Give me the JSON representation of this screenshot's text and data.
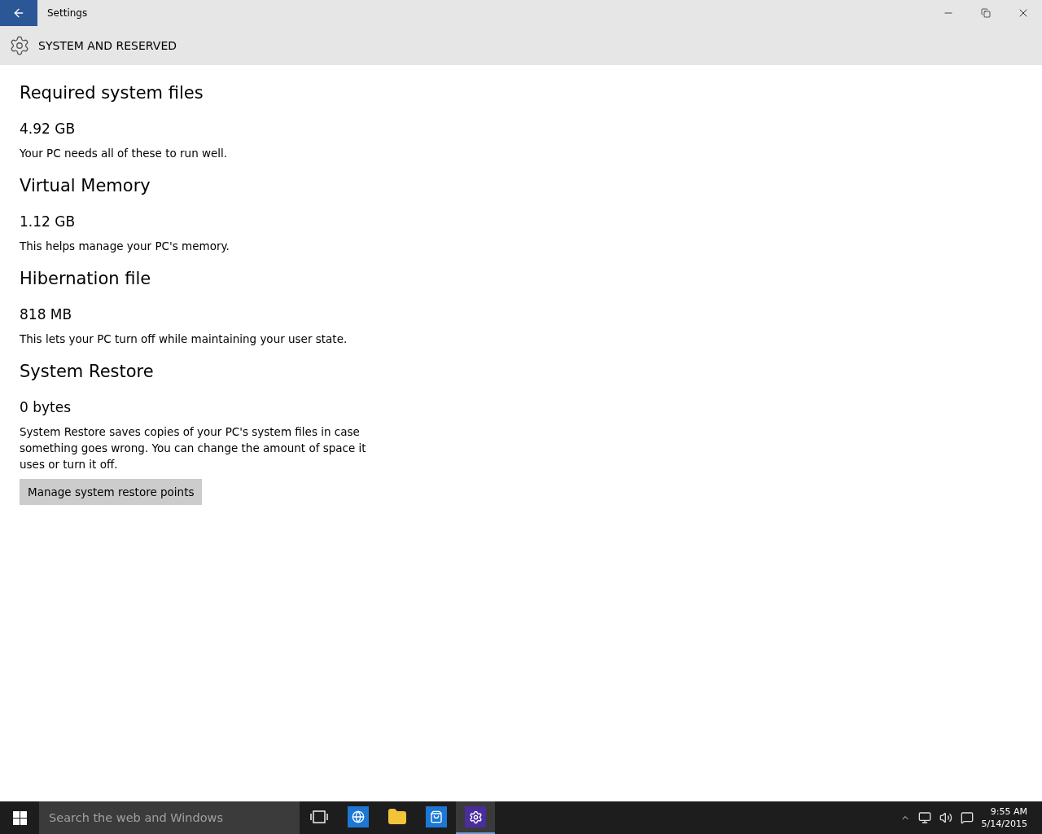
{
  "window": {
    "title": "Settings"
  },
  "header": {
    "title": "SYSTEM AND RESERVED"
  },
  "sections": [
    {
      "title": "Required system files",
      "size": "4.92 GB",
      "description": "Your PC needs all of these to run well."
    },
    {
      "title": "Virtual Memory",
      "size": "1.12 GB",
      "description": "This helps manage your PC's memory."
    },
    {
      "title": "Hibernation file",
      "size": "818 MB",
      "description": "This lets your PC turn off while maintaining your user state."
    },
    {
      "title": "System Restore",
      "size": "0 bytes",
      "description": "System Restore saves copies of your PC's system files in case something goes wrong. You can change the amount of space it uses or turn it off.",
      "button": "Manage system restore points"
    }
  ],
  "taskbar": {
    "search": {
      "placeholder": "Search the web and Windows"
    },
    "apps": [
      {
        "kind": "taskview",
        "selected": false
      },
      {
        "kind": "browser",
        "selected": false
      },
      {
        "kind": "explorer",
        "selected": false
      },
      {
        "kind": "store",
        "selected": false
      },
      {
        "kind": "settings",
        "selected": true
      }
    ],
    "time": "9:55 AM",
    "date": "5/14/2015"
  }
}
